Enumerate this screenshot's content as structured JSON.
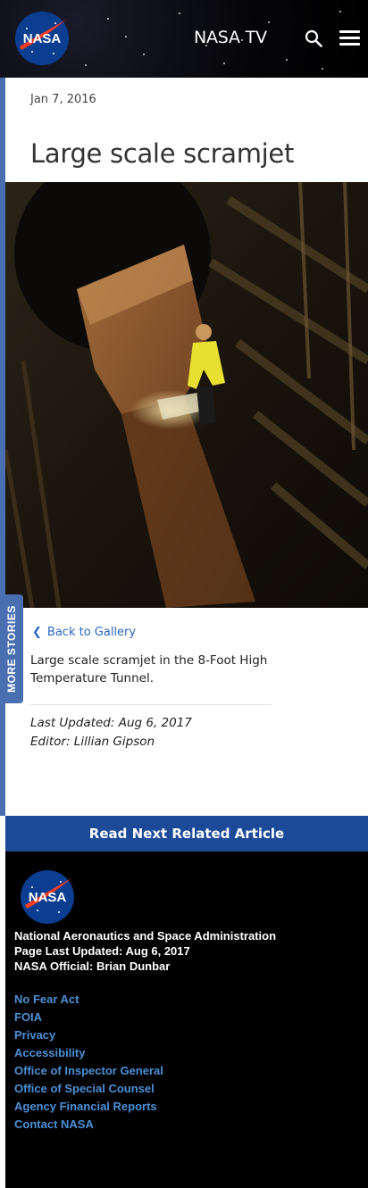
{
  "header": {
    "logo_text": "NASA",
    "tv_label": "NASA TV",
    "search_icon": "search-icon",
    "menu_icon": "hamburger-menu-icon"
  },
  "article": {
    "date": "Jan 7, 2016",
    "title": "Large scale scramjet",
    "image_alt": "Large scale scramjet in wind tunnel",
    "back_label": "Back to Gallery",
    "caption": "Large scale scramjet in the 8-Foot High Temperature Tunnel.",
    "last_updated": "Last Updated: Aug 6, 2017",
    "editor": "Editor: Lillian Gipson"
  },
  "sidebar_tab": {
    "label": "MORE STORIES"
  },
  "read_next": {
    "label": "Read Next Related Article"
  },
  "footer": {
    "logo_text": "NASA",
    "org": "National Aeronautics and Space Administration",
    "page_updated": "Page Last Updated: Aug 6, 2017",
    "official": "NASA Official: Brian Dunbar",
    "links": [
      "No Fear Act",
      "FOIA",
      "Privacy",
      "Accessibility",
      "Office of Inspector General",
      "Office of Special Counsel",
      "Agency Financial Reports",
      "Contact NASA"
    ]
  },
  "colors": {
    "accent_blue": "#1d4a98",
    "strip_blue": "#4a6fb0",
    "link_blue": "#2a66c0",
    "footer_link": "#4d8fd6"
  }
}
